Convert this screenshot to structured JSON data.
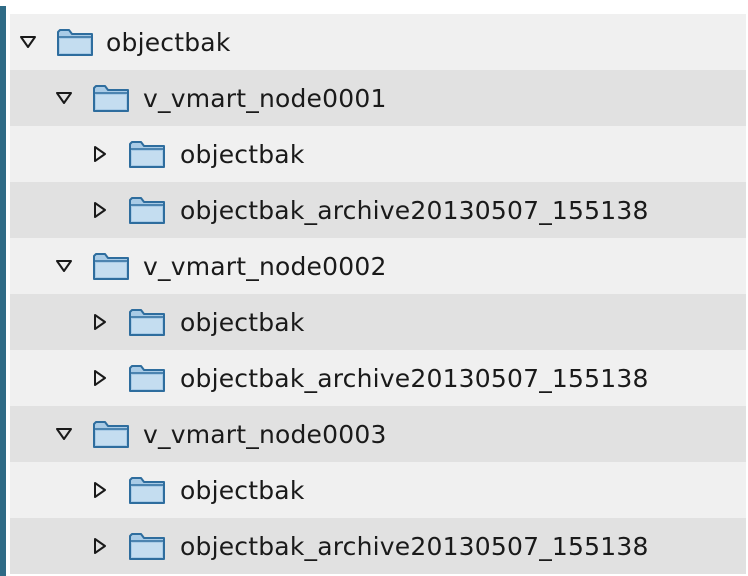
{
  "tree": {
    "nodes": [
      {
        "label": "objectbak",
        "level": 0,
        "expanded": true
      },
      {
        "label": "v_vmart_node0001",
        "level": 1,
        "expanded": true
      },
      {
        "label": "objectbak",
        "level": 2,
        "expanded": false
      },
      {
        "label": "objectbak_archive20130507_155138",
        "level": 2,
        "expanded": false
      },
      {
        "label": "v_vmart_node0002",
        "level": 1,
        "expanded": true
      },
      {
        "label": "objectbak",
        "level": 2,
        "expanded": false
      },
      {
        "label": "objectbak_archive20130507_155138",
        "level": 2,
        "expanded": false
      },
      {
        "label": "v_vmart_node0003",
        "level": 1,
        "expanded": true
      },
      {
        "label": "objectbak",
        "level": 2,
        "expanded": false
      },
      {
        "label": "objectbak_archive20130507_155138",
        "level": 2,
        "expanded": false
      }
    ]
  },
  "icons": {
    "folder": "folder-icon",
    "expanded": "triangle-down-icon",
    "collapsed": "triangle-right-icon"
  },
  "colors": {
    "row_light": "#f0f0f0",
    "row_dark": "#e1e1e1",
    "folder_fill": "#a9cbe6",
    "folder_stroke": "#2e6d9e",
    "border": "#2f6b86"
  }
}
